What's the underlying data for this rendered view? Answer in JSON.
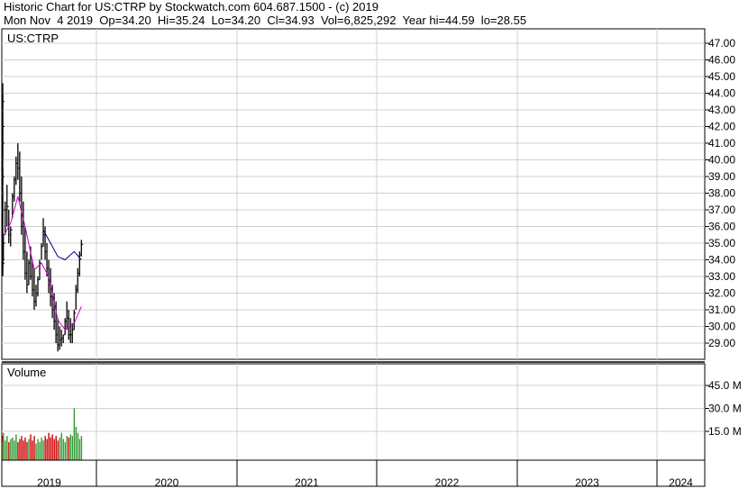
{
  "header": {
    "line1": "Historic Chart for US:CTRP by Stockwatch.com 604.687.1500 - (c) 2019",
    "line2": "Mon Nov  4 2019  Op=34.20  Hi=35.24  Lo=34.20  Cl=34.93  Vol=6,825,292  Year hi=44.59  lo=28.55"
  },
  "chart_data": [
    {
      "type": "ohlc",
      "title": "US:CTRP",
      "y_ticks": [
        "47.00",
        "46.00",
        "45.00",
        "44.00",
        "43.00",
        "42.00",
        "41.00",
        "40.00",
        "39.00",
        "38.00",
        "37.00",
        "36.00",
        "35.00",
        "34.00",
        "33.00",
        "32.00",
        "31.00",
        "30.00",
        "29.00"
      ],
      "ylim": [
        28.0,
        47.5
      ],
      "x_labels": [
        "2019",
        "2020",
        "2021",
        "2022",
        "2023",
        "2024"
      ],
      "grid": true,
      "series": [
        {
          "kind": "price",
          "color": "#000000",
          "x": [
            "2018-11-05",
            "2018-11-12",
            "2018-11-19",
            "2018-11-26",
            "2018-12-03",
            "2018-12-10",
            "2018-12-17",
            "2018-12-24",
            "2018-12-31",
            "2019-01-07",
            "2019-01-14",
            "2019-01-21",
            "2019-01-28",
            "2019-02-04",
            "2019-02-11",
            "2019-02-18",
            "2019-02-25",
            "2019-03-04",
            "2019-03-11",
            "2019-03-18",
            "2019-03-25",
            "2019-04-01",
            "2019-04-08",
            "2019-04-15",
            "2019-04-22",
            "2019-04-29",
            "2019-05-06",
            "2019-05-13",
            "2019-05-20",
            "2019-05-27",
            "2019-06-03",
            "2019-06-10",
            "2019-06-17",
            "2019-06-24",
            "2019-07-01",
            "2019-07-08",
            "2019-07-15",
            "2019-07-22",
            "2019-07-29",
            "2019-08-05",
            "2019-08-12",
            "2019-08-19",
            "2019-08-26",
            "2019-09-02",
            "2019-09-09",
            "2019-09-16",
            "2019-09-23",
            "2019-09-30",
            "2019-10-07",
            "2019-10-14",
            "2019-10-21",
            "2019-10-28",
            "2019-11-04"
          ],
          "high": [
            44.6,
            44.0,
            42.8,
            41.5,
            39.5,
            38.0,
            36.5,
            35.0,
            34.5,
            35.5,
            37.5,
            38.5,
            37.0,
            36.0,
            38.0,
            39.0,
            40.2,
            41.0,
            40.5,
            39.0,
            37.5,
            36.0,
            34.5,
            34.0,
            34.8,
            34.0,
            33.5,
            32.5,
            33.0,
            34.0,
            35.0,
            36.5,
            36.0,
            35.0,
            34.0,
            33.5,
            32.5,
            32.0,
            31.5,
            30.5,
            30.0,
            29.8,
            29.5,
            30.5,
            31.5,
            31.0,
            30.5,
            30.2,
            31.0,
            32.5,
            33.5,
            34.5,
            35.2
          ],
          "low": [
            43.0,
            41.5,
            40.0,
            38.5,
            36.5,
            35.0,
            33.5,
            33.0,
            33.2,
            34.0,
            35.5,
            36.0,
            35.0,
            34.8,
            36.5,
            37.5,
            38.5,
            38.8,
            37.5,
            35.5,
            34.0,
            32.8,
            32.0,
            32.5,
            32.8,
            31.8,
            31.0,
            31.2,
            31.8,
            32.8,
            34.0,
            34.8,
            34.0,
            33.0,
            32.0,
            31.2,
            30.5,
            29.8,
            29.0,
            28.5,
            28.6,
            28.8,
            29.0,
            29.5,
            29.8,
            29.2,
            29.0,
            29.0,
            29.8,
            31.0,
            32.0,
            33.0,
            34.2
          ],
          "close": [
            43.5,
            42.0,
            41.0,
            39.0,
            37.0,
            35.5,
            34.0,
            33.8,
            34.0,
            35.0,
            37.0,
            37.2,
            35.5,
            35.8,
            37.8,
            38.8,
            39.8,
            39.5,
            38.0,
            36.0,
            34.5,
            33.2,
            32.5,
            33.8,
            33.0,
            32.2,
            31.5,
            32.0,
            32.8,
            33.8,
            34.8,
            35.5,
            34.5,
            33.5,
            32.5,
            31.8,
            31.0,
            30.3,
            29.5,
            28.9,
            29.2,
            29.3,
            29.5,
            30.3,
            30.5,
            29.5,
            29.5,
            29.8,
            30.8,
            32.2,
            33.2,
            34.3,
            34.93
          ]
        },
        {
          "kind": "moving_average",
          "color": "#cc00cc",
          "x": [
            "2019-01-07",
            "2019-02-04",
            "2019-03-04",
            "2019-04-01",
            "2019-05-06",
            "2019-06-03",
            "2019-07-01",
            "2019-08-05",
            "2019-09-02",
            "2019-10-07",
            "2019-11-04"
          ],
          "values": [
            35.4,
            36.2,
            37.8,
            36.0,
            33.4,
            33.8,
            33.0,
            30.4,
            29.8,
            30.2,
            31.2
          ]
        },
        {
          "kind": "moving_average",
          "color": "#000080",
          "x": [
            "2019-06-10",
            "2019-07-08",
            "2019-08-05",
            "2019-09-02",
            "2019-10-07",
            "2019-11-04"
          ],
          "values": [
            35.8,
            35.0,
            34.2,
            34.0,
            34.5,
            34.0
          ]
        }
      ]
    },
    {
      "type": "bar",
      "title": "Volume",
      "y_ticks": [
        "45.0 M",
        "30.0 M",
        "15.0 M"
      ],
      "ylim": [
        0,
        55
      ],
      "x": [
        "2018-11-05",
        "2018-11-12",
        "2018-11-19",
        "2018-11-26",
        "2018-12-03",
        "2018-12-10",
        "2018-12-17",
        "2018-12-24",
        "2018-12-31",
        "2019-01-07",
        "2019-01-14",
        "2019-01-21",
        "2019-01-28",
        "2019-02-04",
        "2019-02-11",
        "2019-02-18",
        "2019-02-25",
        "2019-03-04",
        "2019-03-11",
        "2019-03-18",
        "2019-03-25",
        "2019-04-01",
        "2019-04-08",
        "2019-04-15",
        "2019-04-22",
        "2019-04-29",
        "2019-05-06",
        "2019-05-13",
        "2019-05-20",
        "2019-05-27",
        "2019-06-03",
        "2019-06-10",
        "2019-06-17",
        "2019-06-24",
        "2019-07-01",
        "2019-07-08",
        "2019-07-15",
        "2019-07-22",
        "2019-07-29",
        "2019-08-05",
        "2019-08-12",
        "2019-08-19",
        "2019-08-26",
        "2019-09-02",
        "2019-09-09",
        "2019-09-16",
        "2019-09-23",
        "2019-09-30",
        "2019-10-07",
        "2019-10-14",
        "2019-10-21",
        "2019-10-28",
        "2019-11-04"
      ],
      "values": [
        8,
        12,
        10,
        9,
        11,
        7,
        10,
        6,
        8,
        14,
        9,
        12,
        8,
        10,
        11,
        9,
        13,
        8,
        10,
        12,
        9,
        11,
        8,
        10,
        13,
        9,
        12,
        7,
        10,
        8,
        11,
        9,
        12,
        10,
        14,
        11,
        13,
        10,
        12,
        9,
        11,
        14,
        10,
        8,
        12,
        11,
        13,
        12,
        30,
        18,
        14,
        10,
        12
      ],
      "colors_by_up_down": {
        "up": "#339933",
        "down": "#cc0000"
      }
    }
  ]
}
